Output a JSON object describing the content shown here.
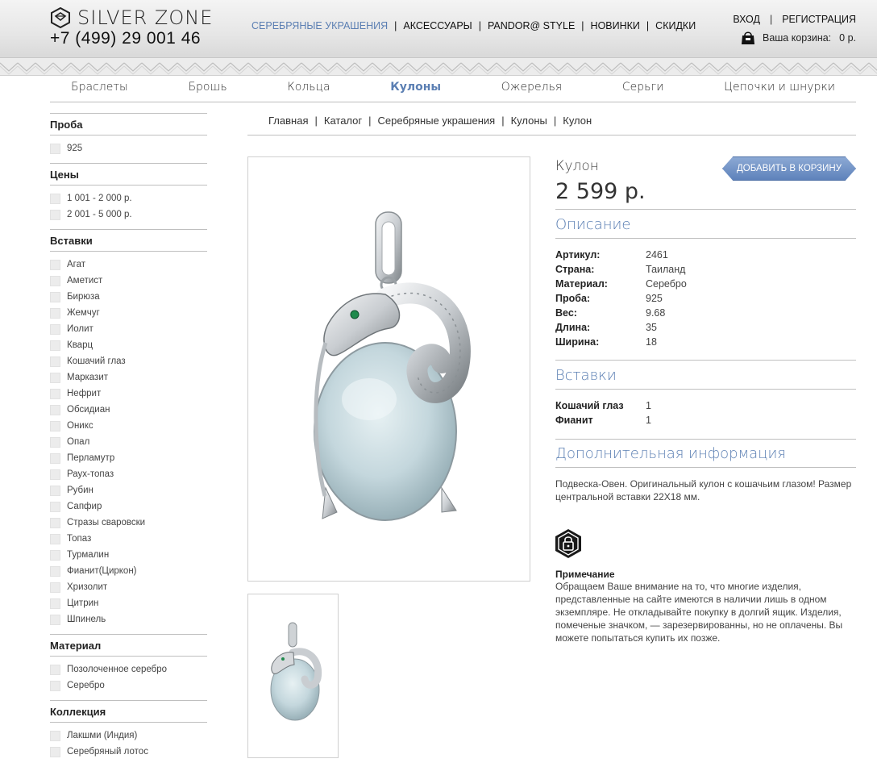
{
  "brand": {
    "name": "SILVER ZONE",
    "phone": "+7 (499) 29 001 46"
  },
  "top_nav": [
    {
      "label": "СЕРЕБРЯНЫЕ УКРАШЕНИЯ",
      "active": true
    },
    {
      "label": "АКСЕССУАРЫ",
      "active": false
    },
    {
      "label": "PANDOR@ STYLE",
      "active": false
    },
    {
      "label": "НОВИНКИ",
      "active": false
    },
    {
      "label": "СКИДКИ",
      "active": false
    }
  ],
  "account": {
    "login": "ВХОД",
    "register": "РЕГИСТРАЦИЯ"
  },
  "cart": {
    "label": "Ваша корзина:",
    "amount": "0 р."
  },
  "categories": [
    {
      "label": "Браслеты",
      "active": false
    },
    {
      "label": "Брошь",
      "active": false
    },
    {
      "label": "Кольца",
      "active": false
    },
    {
      "label": "Кулоны",
      "active": true
    },
    {
      "label": "Ожерелья",
      "active": false
    },
    {
      "label": "Серьги",
      "active": false
    },
    {
      "label": "Цепочки и шнурки",
      "active": false
    }
  ],
  "filters": [
    {
      "title": "Проба",
      "options": [
        "925"
      ]
    },
    {
      "title": "Цены",
      "options": [
        "1 001 - 2 000 р.",
        "2 001 - 5 000 р."
      ]
    },
    {
      "title": "Вставки",
      "options": [
        "Агат",
        "Аметист",
        "Бирюза",
        "Жемчуг",
        "Иолит",
        "Кварц",
        "Кошачий глаз",
        "Марказит",
        "Нефрит",
        "Обсидиан",
        "Оникс",
        "Опал",
        "Перламутр",
        "Раух-топаз",
        "Рубин",
        "Сапфир",
        "Стразы сваровски",
        "Топаз",
        "Турмалин",
        "Фианит(Циркон)",
        "Хризолит",
        "Цитрин",
        "Шпинель"
      ]
    },
    {
      "title": "Материал",
      "options": [
        "Позолоченное серебро",
        "Серебро"
      ]
    },
    {
      "title": "Коллекция",
      "options": [
        "Лакшми (Индия)",
        "Серебряный лотос"
      ]
    }
  ],
  "breadcrumb": [
    "Главная",
    "Каталог",
    "Серебряные украшения",
    "Кулоны",
    "Кулон"
  ],
  "product": {
    "name": "Кулон",
    "price": "2 599 р.",
    "add_to_cart": "ДОБАВИТЬ В КОРЗИНУ",
    "description_title": "Описание",
    "specs": [
      {
        "key": "Артикул:",
        "value": "2461"
      },
      {
        "key": "Страна:",
        "value": "Таиланд"
      },
      {
        "key": "Материал:",
        "value": "Серебро"
      },
      {
        "key": "Проба:",
        "value": "925"
      },
      {
        "key": "Вес:",
        "value": "9.68"
      },
      {
        "key": "Длина:",
        "value": "35"
      },
      {
        "key": "Ширина:",
        "value": "18"
      }
    ],
    "inserts_title": "Вставки",
    "inserts": [
      {
        "key": "Кошачий глаз",
        "value": "1"
      },
      {
        "key": "Фианит",
        "value": "1"
      }
    ],
    "additional_title": "Дополнительная информация",
    "additional_text": "Подвеска-Овен. Оригинальный кулон с кошачьим глазом! Размер центральной вставки 22Х18 мм.",
    "note_title": "Примечание",
    "note_text": "Обращаем Ваше внимание на то, что многие изделия, представленные на сайте имеются в наличии лишь в одном экземпляре. Не откладывайте покупку в долгий ящик. Изделия, помеченые значком, — зарезервированны, но не оплачены. Вы можете попытаться купить их позже."
  },
  "colors": {
    "accent": "#5b7fb3",
    "button": "#6f90c5",
    "stone": "#c3d6dc",
    "silver": "#d9dcdf"
  }
}
